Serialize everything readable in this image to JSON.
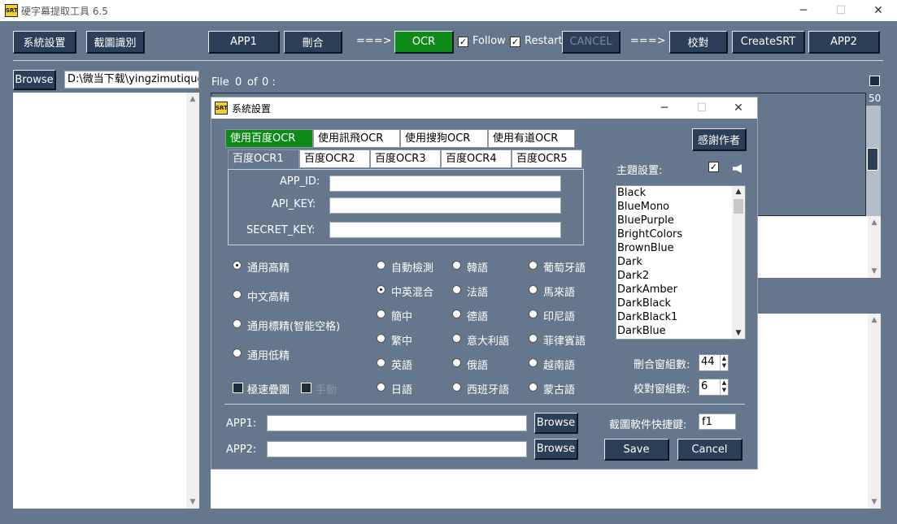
{
  "window": {
    "title": "硬字幕提取工具 6.5",
    "minimize_icon": "─",
    "maximize_icon": "☐",
    "close_icon": "✕",
    "logo_text": "SRT"
  },
  "toolbar": {
    "settings": "系統設置",
    "screenshot_ocr": "截圖識別",
    "app1": "APP1",
    "crop": "刪合",
    "arrow1": "===>",
    "ocr": "OCR",
    "follow": "Follow",
    "restart": "Restart",
    "cancel": "CANCEL",
    "arrow2": "===>",
    "proofread": "校對",
    "create_srt": "CreateSRT",
    "app2": "APP2"
  },
  "file_bar": {
    "browse": "Browse",
    "path": "D:\\微当下载\\yingzimutiqugongju",
    "file_label": "File",
    "file_index": "0",
    "of": "of",
    "file_total": "0 :",
    "slider_value": "50"
  },
  "dialog": {
    "title": "系統設置",
    "engine_tabs": [
      "使用百度OCR",
      "使用訊飛OCR",
      "使用搜狗OCR",
      "使用有道OCR"
    ],
    "thanks_button": "感謝作者",
    "sub_tabs": [
      "百度OCR1",
      "百度OCR2",
      "百度OCR3",
      "百度OCR4",
      "百度OCR5"
    ],
    "app_id_label": "APP_ID:",
    "api_key_label": "API_KEY:",
    "secret_key_label": "SECRET_KEY:",
    "app_id_value": "",
    "api_key_value": "",
    "secret_key_value": "",
    "theme_label": "主題設置:",
    "themes": [
      "Black",
      "BlueMono",
      "BluePurple",
      "BrightColors",
      "BrownBlue",
      "Dark",
      "Dark2",
      "DarkAmber",
      "DarkBlack",
      "DarkBlack1",
      "DarkBlue"
    ],
    "modes": [
      "通用高精",
      "中文高精",
      "通用標精(智能空格)",
      "通用低精"
    ],
    "fast_stack": "極速疊圖",
    "manual": "手動",
    "lang_col1": [
      "自動檢測",
      "中英混合",
      "簡中",
      "繁中",
      "英語",
      "日語"
    ],
    "lang_col2": [
      "韓語",
      "法語",
      "德語",
      "意大利語",
      "俄語",
      "西班牙語"
    ],
    "lang_col3": [
      "葡萄牙語",
      "馬來語",
      "印尼語",
      "菲律賓語",
      "越南語",
      "蒙古語"
    ],
    "crop_groups_label": "刪合窗組數:",
    "crop_groups_value": "44",
    "proof_groups_label": "校對窗組數:",
    "proof_groups_value": "6",
    "app1_label": "APP1:",
    "app2_label": "APP2:",
    "app1_path": "",
    "app2_path": "",
    "browse": "Browse",
    "hotkey_label": "截圖軟件快捷鍵:",
    "hotkey_value": "f1",
    "save": "Save",
    "cancel": "Cancel"
  },
  "colors": {
    "background": "#64778d",
    "button": "#2b3f59",
    "active_green": "#0d8a18"
  }
}
